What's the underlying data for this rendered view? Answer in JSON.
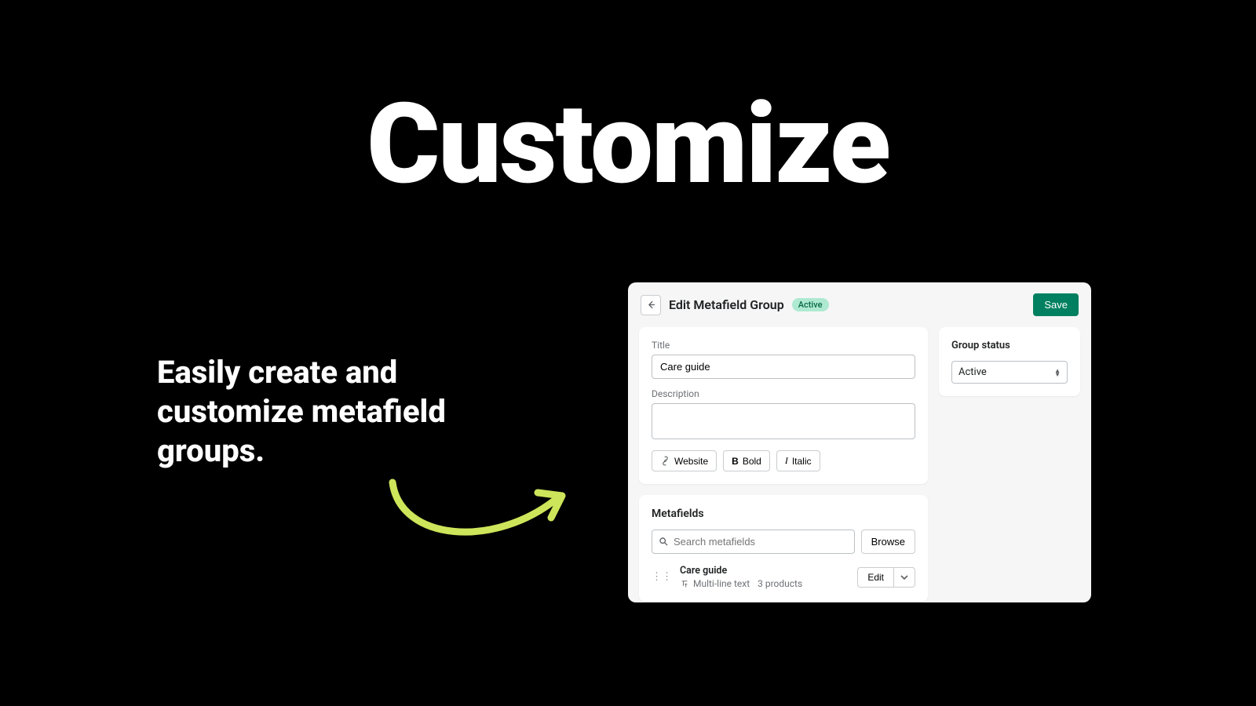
{
  "hero": {
    "title": "Customize"
  },
  "tagline": "Easily create and customize metafield groups.",
  "panel": {
    "title": "Edit Metafield Group",
    "badge": "Active",
    "save": "Save",
    "form": {
      "title_label": "Title",
      "title_value": "Care guide",
      "desc_label": "Description",
      "toolbar": {
        "website": "Website",
        "bold": "Bold",
        "italic": "Italic"
      }
    },
    "metafields": {
      "heading": "Metafields",
      "search_placeholder": "Search metafields",
      "browse": "Browse",
      "item": {
        "name": "Care guide",
        "type": "Multi-line text",
        "count": "3 products",
        "edit": "Edit"
      }
    },
    "sidebar": {
      "heading": "Group status",
      "value": "Active"
    }
  }
}
